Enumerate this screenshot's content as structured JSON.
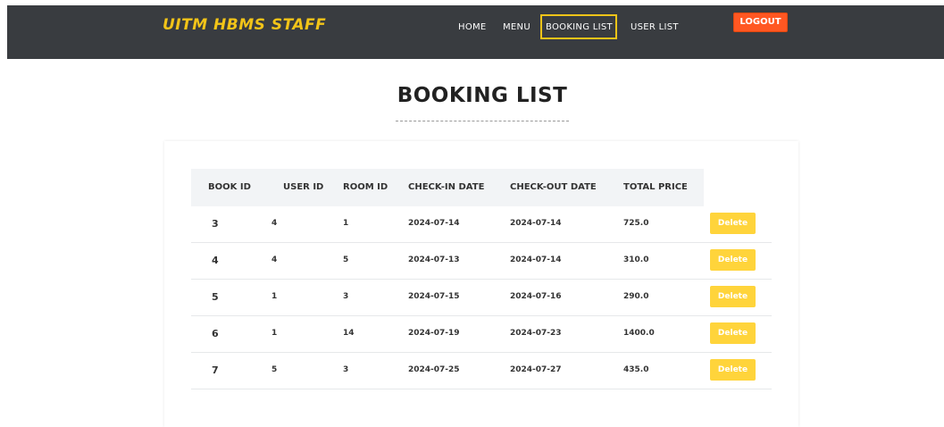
{
  "navbar": {
    "brand": "UITM HBMS STAFF",
    "links": [
      "HOME",
      "MENU",
      "BOOKING LIST",
      "USER LIST"
    ],
    "active_link": "BOOKING LIST",
    "logout_label": "LOGOUT"
  },
  "page": {
    "title": "BOOKING LIST"
  },
  "table": {
    "headers": [
      "BOOK ID",
      "USER ID",
      "ROOM ID",
      "CHECK-IN DATE",
      "CHECK-OUT DATE",
      "TOTAL PRICE"
    ],
    "rows": [
      {
        "book_id": "3",
        "user_id": "4",
        "room_id": "1",
        "check_in": "2024-07-14",
        "check_out": "2024-07-14",
        "total_price": "725.0",
        "action": "Delete"
      },
      {
        "book_id": "4",
        "user_id": "4",
        "room_id": "5",
        "check_in": "2024-07-13",
        "check_out": "2024-07-14",
        "total_price": "310.0",
        "action": "Delete"
      },
      {
        "book_id": "5",
        "user_id": "1",
        "room_id": "3",
        "check_in": "2024-07-15",
        "check_out": "2024-07-16",
        "total_price": "290.0",
        "action": "Delete"
      },
      {
        "book_id": "6",
        "user_id": "1",
        "room_id": "14",
        "check_in": "2024-07-19",
        "check_out": "2024-07-23",
        "total_price": "1400.0",
        "action": "Delete"
      },
      {
        "book_id": "7",
        "user_id": "5",
        "room_id": "3",
        "check_in": "2024-07-25",
        "check_out": "2024-07-27",
        "total_price": "435.0",
        "action": "Delete"
      }
    ]
  },
  "colors": {
    "navbar_bg": "#393c40",
    "brand": "#f2c418",
    "active_border": "#f2c418",
    "logout_bg": "#ff5722",
    "delete_bg": "#ffd43b"
  }
}
